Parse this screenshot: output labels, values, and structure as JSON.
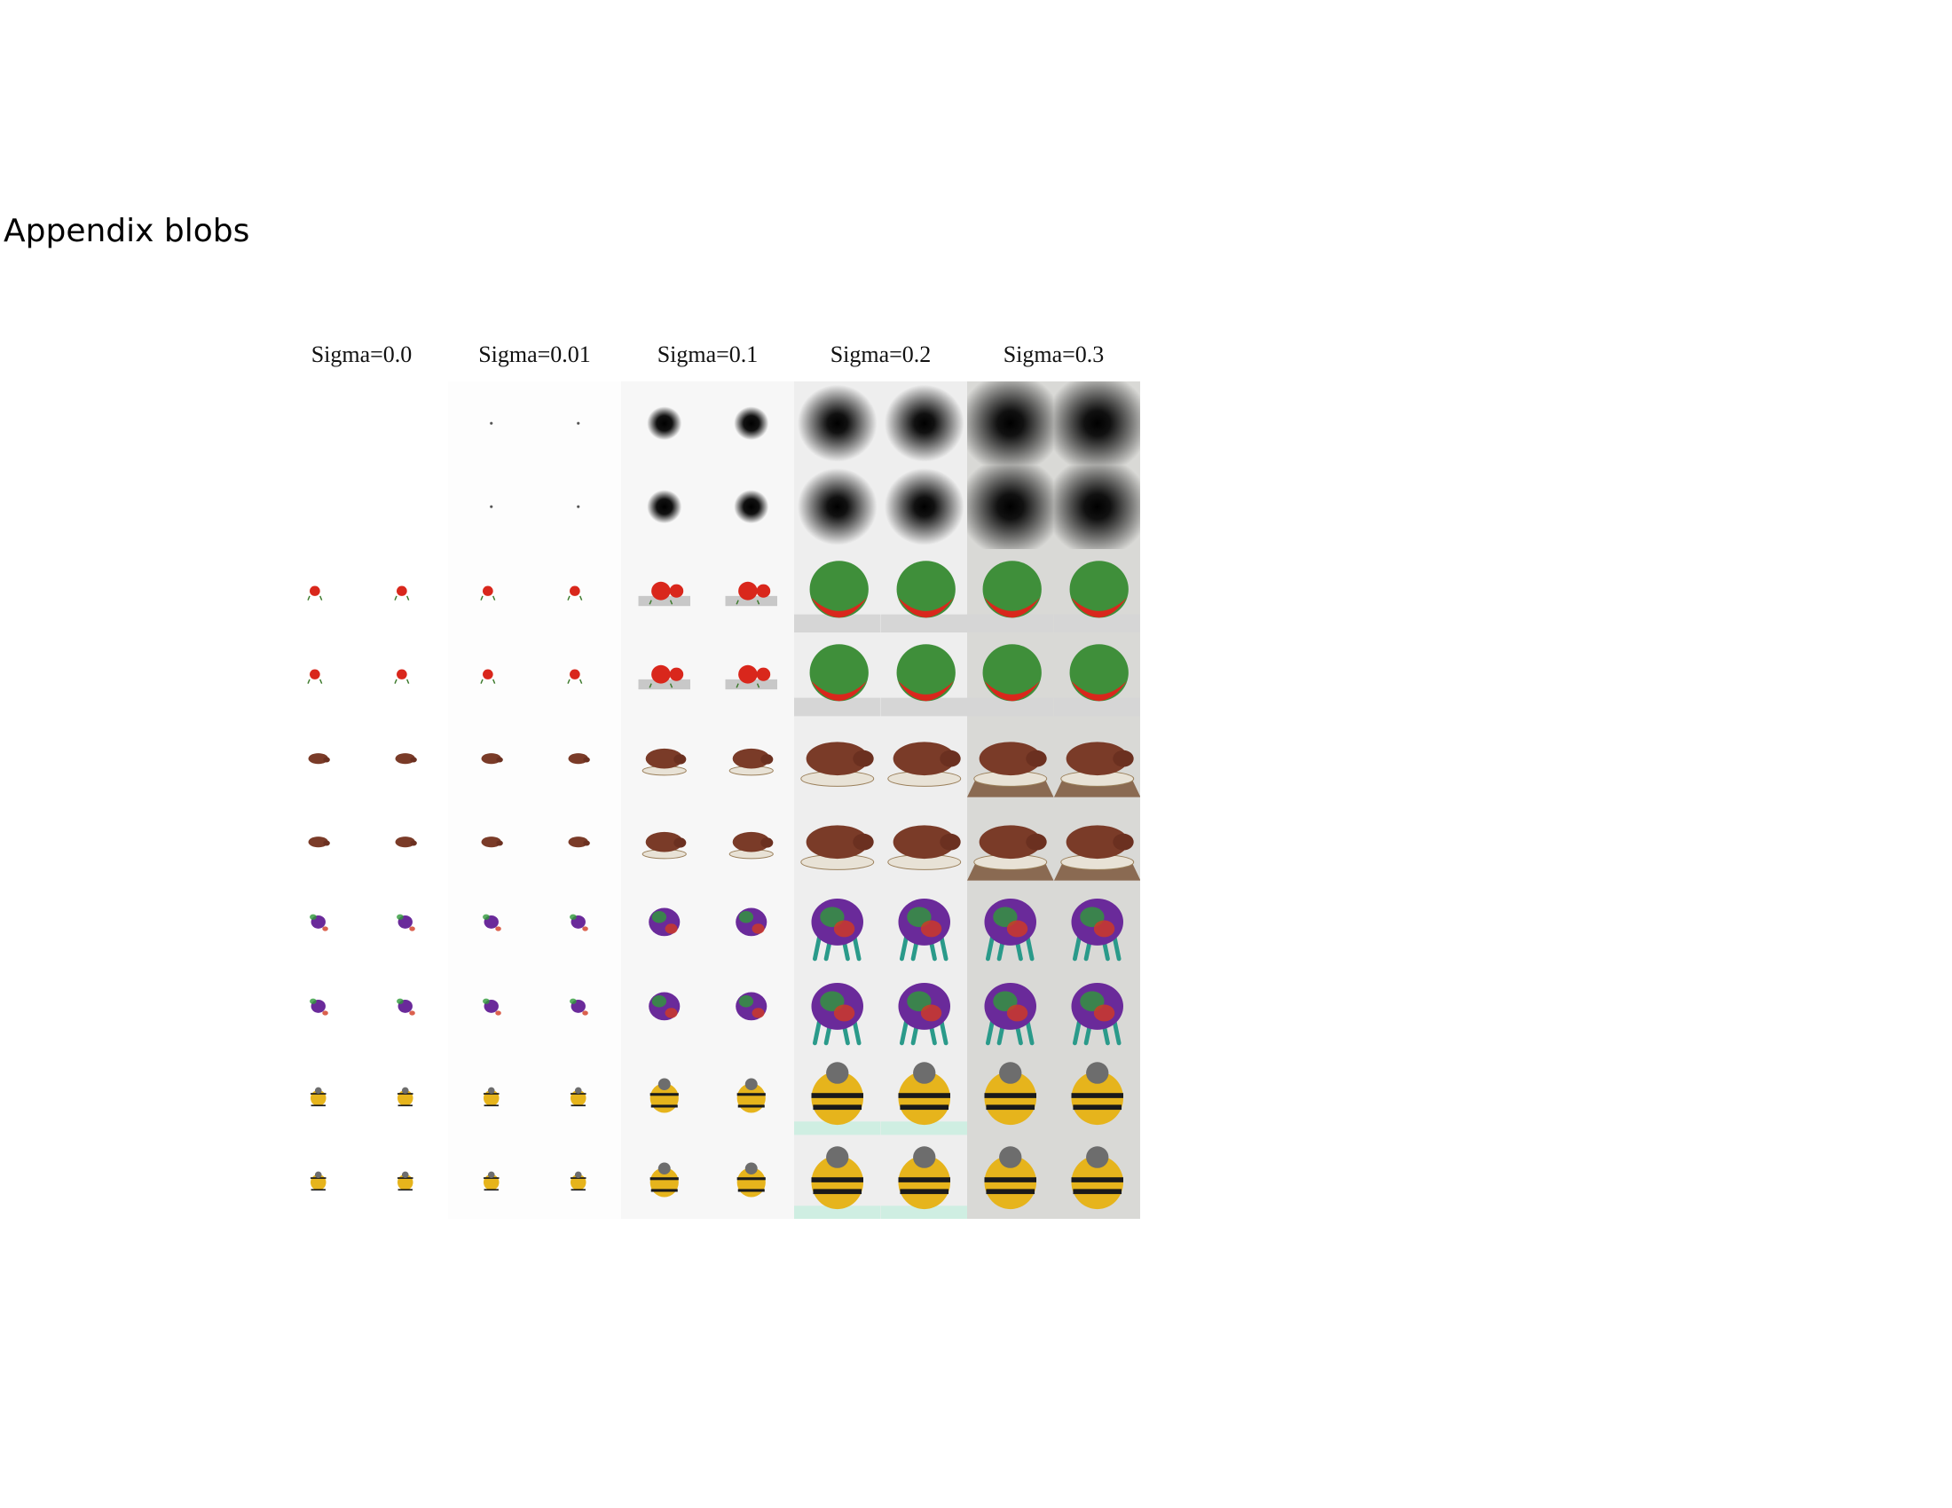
{
  "page": {
    "title": "Appendix blobs"
  },
  "figure": {
    "columns": [
      {
        "label": "Sigma=0.0",
        "sigma": 0.0,
        "bg": "#ffffff"
      },
      {
        "label": "Sigma=0.01",
        "sigma": 0.01,
        "bg": "#fdfdfd"
      },
      {
        "label": "Sigma=0.1",
        "sigma": 0.1,
        "bg": "#f7f7f7"
      },
      {
        "label": "Sigma=0.2",
        "sigma": 0.2,
        "bg": "#eeeeee"
      },
      {
        "label": "Sigma=0.3",
        "sigma": 0.3,
        "bg": "#d9d9d6"
      }
    ],
    "rows": [
      {
        "kind": "blob"
      },
      {
        "kind": "blob"
      },
      {
        "kind": "tomato"
      },
      {
        "kind": "tomato"
      },
      {
        "kind": "hippo"
      },
      {
        "kind": "hippo"
      },
      {
        "kind": "spider"
      },
      {
        "kind": "spider"
      },
      {
        "kind": "bee-cat"
      },
      {
        "kind": "bee-cat"
      }
    ],
    "object_colors": {
      "tomato-red": "#d9271c",
      "tomato-green": "#3f8f3a",
      "hippo-brown": "#7a3b28",
      "spider-purple": "#6a2a9a",
      "spider-teal": "#2a9a8a",
      "bee-yellow": "#e6b41c",
      "bee-black": "#1a1a1a",
      "cat-grey": "#6d6d6d"
    }
  }
}
